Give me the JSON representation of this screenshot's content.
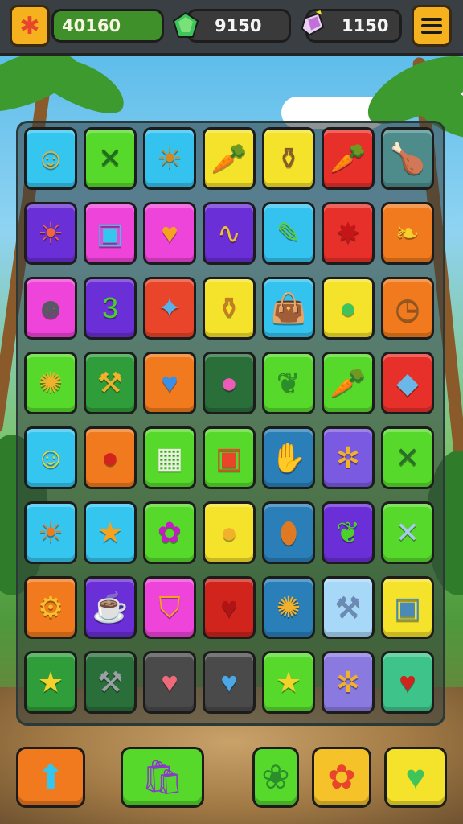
{
  "header": {
    "coins_value": "40160",
    "gems_value": "9150",
    "crystals_value": "1150",
    "settings_icon": "puzzle-piece-icon",
    "menu_icon": "hamburger-menu-icon"
  },
  "board": {
    "rows": [
      [
        {
          "icon": "smiley-sun-icon",
          "glyph": "☺",
          "bg": "#35c6ef",
          "fg": "#f2b12a"
        },
        {
          "icon": "crossed-sticks-icon",
          "glyph": "✕",
          "bg": "#57d92b",
          "fg": "#1e6e1e"
        },
        {
          "icon": "sun-picture-icon",
          "glyph": "☀",
          "bg": "#34c2ee",
          "fg": "#d48a1e"
        },
        {
          "icon": "carrot-icon",
          "glyph": "🥕",
          "bg": "#f5e22b",
          "fg": "#f07d21"
        },
        {
          "icon": "jar-icon",
          "glyph": "⚱",
          "bg": "#f5e22b",
          "fg": "#8a5a2b"
        },
        {
          "icon": "carrot-icon",
          "glyph": "🥕",
          "bg": "#e8302a",
          "fg": "#f07d21"
        },
        {
          "icon": "drumstick-icon",
          "glyph": "🍗",
          "bg": "#4e8c8c",
          "fg": "#e7a23e"
        }
      ],
      [
        {
          "icon": "sun-face-icon",
          "glyph": "☀",
          "bg": "#6a2fd6",
          "fg": "#f0663a"
        },
        {
          "icon": "monitor-icon",
          "glyph": "▣",
          "bg": "#ee44d9",
          "fg": "#35c6ef"
        },
        {
          "icon": "heart-icon",
          "glyph": "♥",
          "bg": "#ee44d9",
          "fg": "#f5a21e"
        },
        {
          "icon": "squiggle-icon",
          "glyph": "∿",
          "bg": "#6a2fd6",
          "fg": "#f2c12a"
        },
        {
          "icon": "brush-icon",
          "glyph": "✎",
          "bg": "#34c2ee",
          "fg": "#62d12a"
        },
        {
          "icon": "splat-icon",
          "glyph": "✸",
          "bg": "#e8302a",
          "fg": "#c41616"
        },
        {
          "icon": "leaf-icon",
          "glyph": "❧",
          "bg": "#f07a1d",
          "fg": "#f5d22a"
        }
      ],
      [
        {
          "icon": "robot-face-icon",
          "glyph": "☻",
          "bg": "#ee44d9",
          "fg": "#555a62"
        },
        {
          "icon": "number-three-icon",
          "glyph": "3",
          "bg": "#6a2fd6",
          "fg": "#4bd12a"
        },
        {
          "icon": "crystal-creature-icon",
          "glyph": "✦",
          "bg": "#e8452a",
          "fg": "#5ab0e8"
        },
        {
          "icon": "vase-icon",
          "glyph": "⚱",
          "bg": "#f5e22b",
          "fg": "#c87a25"
        },
        {
          "icon": "bag-icon",
          "glyph": "👜",
          "bg": "#34c2ee",
          "fg": "#e548d0"
        },
        {
          "icon": "apple-icon",
          "glyph": "●",
          "bg": "#f5e22b",
          "fg": "#3ec45a"
        },
        {
          "icon": "clock-nut-icon",
          "glyph": "◷",
          "bg": "#f07a1d",
          "fg": "#8a5a2b"
        }
      ],
      [
        {
          "icon": "gear-creature-icon",
          "glyph": "✺",
          "bg": "#57d92b",
          "fg": "#f2b12a"
        },
        {
          "icon": "hammer-icon",
          "glyph": "⚒",
          "bg": "#2f9e3a",
          "fg": "#f2b12a"
        },
        {
          "icon": "heart-icon",
          "glyph": "♥",
          "bg": "#f07a1d",
          "fg": "#3a8fe8"
        },
        {
          "icon": "balloon-icon",
          "glyph": "●",
          "bg": "#2a6e3a",
          "fg": "#ee5ab8"
        },
        {
          "icon": "leaf-icon",
          "glyph": "❦",
          "bg": "#57d92b",
          "fg": "#2a8e2a"
        },
        {
          "icon": "carrot-icon",
          "glyph": "🥕",
          "bg": "#57d92b",
          "fg": "#f07d21"
        },
        {
          "icon": "kite-icon",
          "glyph": "◆",
          "bg": "#e8302a",
          "fg": "#6ab8e8"
        }
      ],
      [
        {
          "icon": "smiley-face-icon",
          "glyph": "☺",
          "bg": "#35c6ef",
          "fg": "#f5d22a"
        },
        {
          "icon": "cherries-icon",
          "glyph": "●",
          "bg": "#f07a1d",
          "fg": "#d0241c"
        },
        {
          "icon": "calendar-icon",
          "glyph": "▦",
          "bg": "#57d92b",
          "fg": "#e8f0e0"
        },
        {
          "icon": "treasure-box-icon",
          "glyph": "▣",
          "bg": "#57d92b",
          "fg": "#e8452a"
        },
        {
          "icon": "hand-icon",
          "glyph": "✋",
          "bg": "#2a7fb8",
          "fg": "#c87a4a"
        },
        {
          "icon": "critter-icon",
          "glyph": "✲",
          "bg": "#7a5ae0",
          "fg": "#f2b12a"
        },
        {
          "icon": "crossed-tools-icon",
          "glyph": "✕",
          "bg": "#57d92b",
          "fg": "#2a6e2a"
        }
      ],
      [
        {
          "icon": "sun-icon",
          "glyph": "☀",
          "bg": "#35c6ef",
          "fg": "#f07a1d"
        },
        {
          "icon": "star-icon",
          "glyph": "★",
          "bg": "#35c6ef",
          "fg": "#f5a21e"
        },
        {
          "icon": "blob-icon",
          "glyph": "✿",
          "bg": "#57d92b",
          "fg": "#c41cc4"
        },
        {
          "icon": "lemon-icon",
          "glyph": "●",
          "bg": "#f5e22b",
          "fg": "#f2b12a"
        },
        {
          "icon": "bread-icon",
          "glyph": "⬮",
          "bg": "#2a7fb8",
          "fg": "#e07a22"
        },
        {
          "icon": "chili-icon",
          "glyph": "❦",
          "bg": "#6a2fd6",
          "fg": "#4bd12a"
        },
        {
          "icon": "crossed-swords-icon",
          "glyph": "✕",
          "bg": "#57d92b",
          "fg": "#a8c8f0"
        }
      ],
      [
        {
          "icon": "gear-sun-icon",
          "glyph": "⚙",
          "bg": "#f07a1d",
          "fg": "#f5c22a"
        },
        {
          "icon": "mug-icon",
          "glyph": "☕",
          "bg": "#6a2fd6",
          "fg": "#f5d22a"
        },
        {
          "icon": "shield-icon",
          "glyph": "⛉",
          "bg": "#ee44d9",
          "fg": "#f5a21e"
        },
        {
          "icon": "heart-icon",
          "glyph": "♥",
          "bg": "#d0241c",
          "fg": "#b01414"
        },
        {
          "icon": "fish-icon",
          "glyph": "✺",
          "bg": "#2a7fb8",
          "fg": "#f2b12a"
        },
        {
          "icon": "hammer-icon",
          "glyph": "⚒",
          "bg": "#a8d8f8",
          "fg": "#6a8ab8"
        },
        {
          "icon": "backpack-icon",
          "glyph": "▣",
          "bg": "#f5e22b",
          "fg": "#4a8ab8"
        }
      ],
      [
        {
          "icon": "star-icon",
          "glyph": "★",
          "bg": "#2f9e3a",
          "fg": "#f5d22a"
        },
        {
          "icon": "wrench-icon",
          "glyph": "⚒",
          "bg": "#2a6e3a",
          "fg": "#9aa0a6"
        },
        {
          "icon": "heart-icon",
          "glyph": "♥",
          "bg": "#4a4a4a",
          "fg": "#ee6a7a"
        },
        {
          "icon": "drop-icon",
          "glyph": "♥",
          "bg": "#4a4a4a",
          "fg": "#4aa8e8"
        },
        {
          "icon": "star-icon",
          "glyph": "★",
          "bg": "#57d92b",
          "fg": "#f5d22a"
        },
        {
          "icon": "sun-creature-icon",
          "glyph": "✲",
          "bg": "#8a7ae0",
          "fg": "#f2b12a"
        },
        {
          "icon": "heart-icon",
          "glyph": "♥",
          "bg": "#3ec48a",
          "fg": "#d0241c"
        }
      ]
    ]
  },
  "footer": {
    "buttons": [
      {
        "name": "arrow-button",
        "icon": "up-arrow-icon",
        "glyph": "⬆",
        "bg": "#f07a1d",
        "fg": "#35c6ef"
      },
      {
        "name": "shop-button",
        "icon": "shopping-bag-icon",
        "glyph": "🛍",
        "bg": "#57d92b",
        "fg": "#8a3ac8"
      },
      {
        "name": "boost-button",
        "icon": "paw-icon",
        "glyph": "❀",
        "bg": "#57d92b",
        "fg": "#2a8e2a"
      },
      {
        "name": "flower-button",
        "icon": "flower-icon",
        "glyph": "✿",
        "bg": "#f5c22a",
        "fg": "#e8452a"
      },
      {
        "name": "lives-button",
        "icon": "heart-icon",
        "glyph": "♥",
        "bg": "#f5e22b",
        "fg": "#3ec45a"
      }
    ]
  }
}
